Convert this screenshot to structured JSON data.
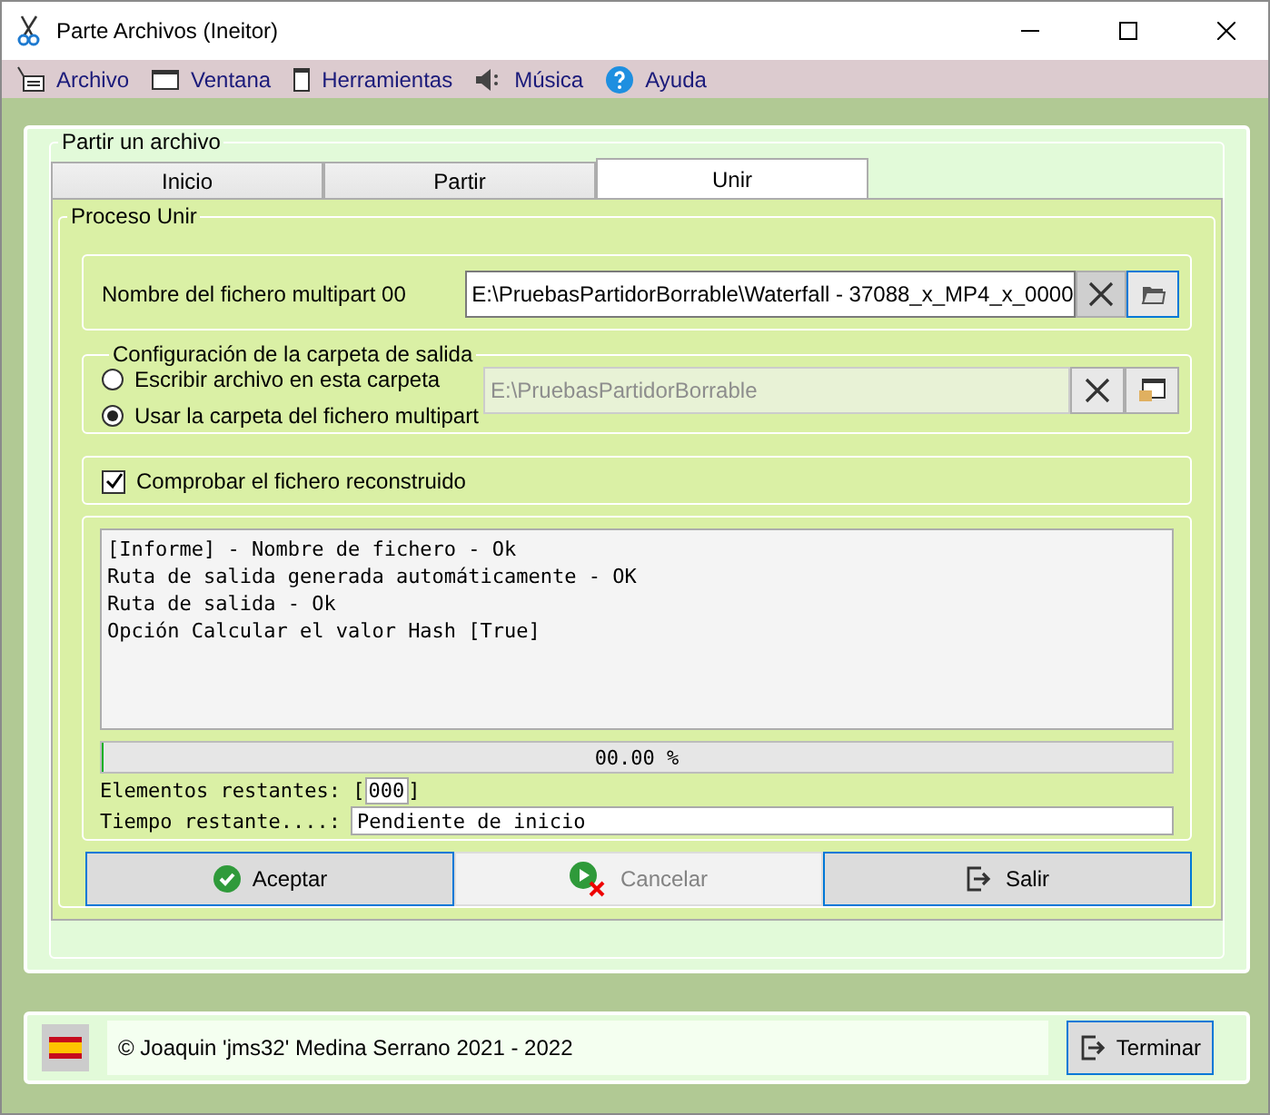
{
  "window": {
    "title": "Parte Archivos (Ineitor)"
  },
  "menu": [
    {
      "label": "Archivo",
      "kind": "file"
    },
    {
      "label": "Ventana",
      "kind": "window"
    },
    {
      "label": "Herramientas",
      "kind": "tools"
    },
    {
      "label": "Música",
      "kind": "music"
    },
    {
      "label": "Ayuda",
      "kind": "help"
    }
  ],
  "group": {
    "title": "Partir un archivo"
  },
  "tabs": [
    {
      "label": "Inicio",
      "selected": false
    },
    {
      "label": "Partir",
      "selected": false
    },
    {
      "label": "Unir",
      "selected": true
    }
  ],
  "process": {
    "title": "Proceso Unir",
    "file_label": "Nombre del fichero multipart 00",
    "file_value": "E:\\PruebasPartidorBorrable\\Waterfall - 37088_x_MP4_x_0000",
    "output": {
      "title": "Configuración de la carpeta de salida",
      "folder_value": "E:\\PruebasPartidorBorrable",
      "options": [
        {
          "label": "Escribir archivo en esta carpeta",
          "selected": false
        },
        {
          "label": "Usar la carpeta del fichero multipart",
          "selected": true
        }
      ]
    },
    "verify": {
      "label": "Comprobar el fichero reconstruido",
      "checked": true
    },
    "log": [
      "[Informe] - Nombre de fichero - Ok",
      "Ruta de salida generada automáticamente - OK",
      "Ruta de salida - Ok",
      "Opción Calcular el valor Hash [True]"
    ],
    "progress": {
      "level": 0,
      "reading": "00.00 %"
    },
    "remaining_items": {
      "label": "Elementos restantes: [",
      "value": "000",
      "end": "]"
    },
    "remaining_time": {
      "label": "Tiempo restante....:",
      "value": "Pendiente de inicio"
    }
  },
  "actions": [
    {
      "label": "Aceptar",
      "kind": "accept",
      "disabled": false
    },
    {
      "label": "Cancelar",
      "kind": "cancel",
      "disabled": true
    },
    {
      "label": "Salir",
      "kind": "exit",
      "disabled": false
    }
  ],
  "footer": {
    "copyright": "© Joaquin 'jms32' Medina Serrano 2021 - 2022",
    "button": "Terminar"
  }
}
